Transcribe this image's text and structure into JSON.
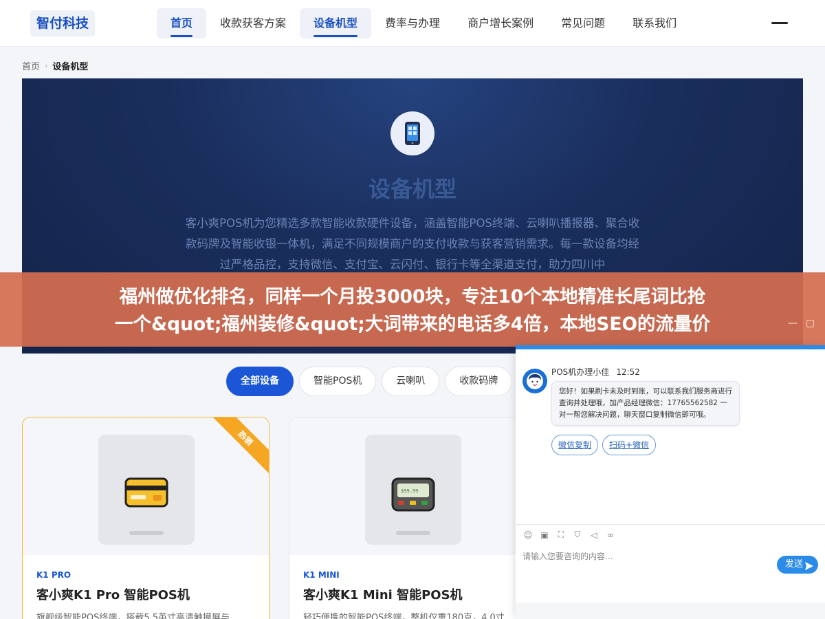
{
  "header": {
    "logo": "智付科技",
    "nav": [
      "首页",
      "收款获客方案",
      "设备机型",
      "费率与办理",
      "商户增长案例",
      "常见问题",
      "联系我们"
    ],
    "active_nav": [
      "首页",
      "设备机型"
    ]
  },
  "breadcrumb": {
    "home": "首页",
    "current": "设备机型"
  },
  "hero": {
    "icon": "phone-icon",
    "title": "设备机型",
    "description": "客小爽POS机为您精选多款智能收款硬件设备，涵盖智能POS终端、云喇叭播报器、聚合收款码牌及智能收银一体机，满足不同规模商户的支付收款与获客营销需求。每一款设备均经过严格品控，支持微信、支付宝、云闪付、银行卡等全渠道支付，助力四川中"
  },
  "banner": {
    "line1": "福州做优化排名，同样一个月投3000块，专注10个本地精准长尾词比抢",
    "line2": "一个&quot;福州装修&quot;大词带来的电话多4倍，本地SEO的流量价"
  },
  "filters": [
    "全部设备",
    "智能POS机",
    "云喇叭",
    "收款码牌"
  ],
  "products": [
    {
      "code": "K1 PRO",
      "name": "客小爽K1 Pro 智能POS机",
      "desc": "旗舰级智能POS终端，搭载5.5英寸高清触摸屏与",
      "badge": "热销",
      "icon": "card-icon"
    },
    {
      "code": "K1 MINI",
      "name": "客小爽K1 Mini 智能POS机",
      "desc": "轻巧便携的智能POS终端，整机仅重180克，4.0寸",
      "icon": "pos-device-icon"
    }
  ],
  "chat": {
    "sender": "POS机办理小佳",
    "time": "12:52",
    "message": "您好！如果刷卡未及时到账，可以联系我们服务商进行查询并处理哦，加产品经理微信：17765562582 一对一帮您解决问题，聊天窗口复制微信即可哦。",
    "actions": [
      "微信复制",
      "扫码+微信"
    ],
    "placeholder": "请输入您要咨询的内容...",
    "send": "发送"
  },
  "colors": {
    "brand": "#1a56d6",
    "banner": "#d46e50",
    "hot": "#f5a623",
    "chat": "#2a8be8"
  }
}
